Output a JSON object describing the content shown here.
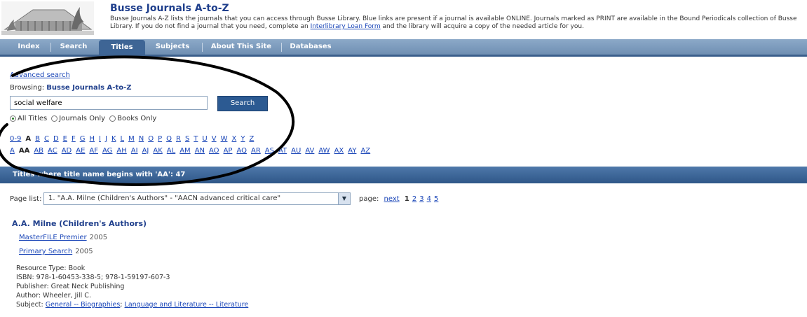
{
  "header": {
    "title": "Busse Journals A-to-Z",
    "description": "Busse Journals A-Z lists the journals that you can access through Busse Library. Blue links are present if a journal is available ONLINE. Journals marked as PRINT are available in the Bound Periodicals collection of Busse Library. If you do not find a journal that you need, complete an ",
    "ill_link": "Interlibrary Loan Form",
    "description_end": " and the library will acquire a copy of the needed article for you."
  },
  "nav": {
    "items": [
      "Index",
      "Search",
      "Titles",
      "Subjects",
      "About This Site",
      "Databases"
    ],
    "active": "Titles"
  },
  "search": {
    "advanced_link": "Advanced search",
    "browsing_label": "Browsing:",
    "browsing_value": "Busse Journals A-to-Z",
    "input_value": "social welfare",
    "button_label": "Search",
    "options": [
      "All Titles",
      "Journals Only",
      "Books Only"
    ],
    "selected_option": "All Titles"
  },
  "alphabet": {
    "row1": [
      "0-9",
      "A",
      "B",
      "C",
      "D",
      "E",
      "F",
      "G",
      "H",
      "I",
      "J",
      "K",
      "L",
      "M",
      "N",
      "O",
      "P",
      "Q",
      "R",
      "S",
      "T",
      "U",
      "V",
      "W",
      "X",
      "Y",
      "Z"
    ],
    "row1_current": "A",
    "row2": [
      "A",
      "AA",
      "AB",
      "AC",
      "AD",
      "AE",
      "AF",
      "AG",
      "AH",
      "AI",
      "AJ",
      "AK",
      "AL",
      "AM",
      "AN",
      "AO",
      "AP",
      "AQ",
      "AR",
      "AS",
      "AT",
      "AU",
      "AV",
      "AW",
      "AX",
      "AY",
      "AZ"
    ],
    "row2_current": "AA"
  },
  "results": {
    "bar_text": "Titles where title name begins with 'AA': 47",
    "page_list_label": "Page list:",
    "page_list_value": "1. \"A.A. Milne (Children's Authors\" - \"AACN advanced critical care\"",
    "page_label": "page:",
    "next_label": "next",
    "pages": [
      "1",
      "2",
      "3",
      "4",
      "5"
    ],
    "current_page": "1"
  },
  "record": {
    "title": "A.A. Milne (Children's Authors)",
    "sources": [
      {
        "name": "MasterFILE Premier",
        "year": "2005"
      },
      {
        "name": "Primary Search",
        "year": "2005"
      }
    ],
    "resource_type": "Resource Type: Book",
    "isbn": "ISBN: 978-1-60453-338-5; 978-1-59197-607-3",
    "publisher": "Publisher: Great Neck Publishing",
    "author": "Author: Wheeler, Jill C.",
    "subject_label": "Subject:",
    "subjects": [
      "General -- Biographies",
      "Language and Literature -- Literature"
    ]
  },
  "colors": {
    "nav_bg": "#7a98bc",
    "nav_active": "#3e6595",
    "title_blue": "#1f3f8c",
    "link_blue": "#1a46b8",
    "result_bar": "#3a6398"
  },
  "icons": {
    "logo": "building-logo",
    "dropdown": "chevron-down-icon"
  }
}
